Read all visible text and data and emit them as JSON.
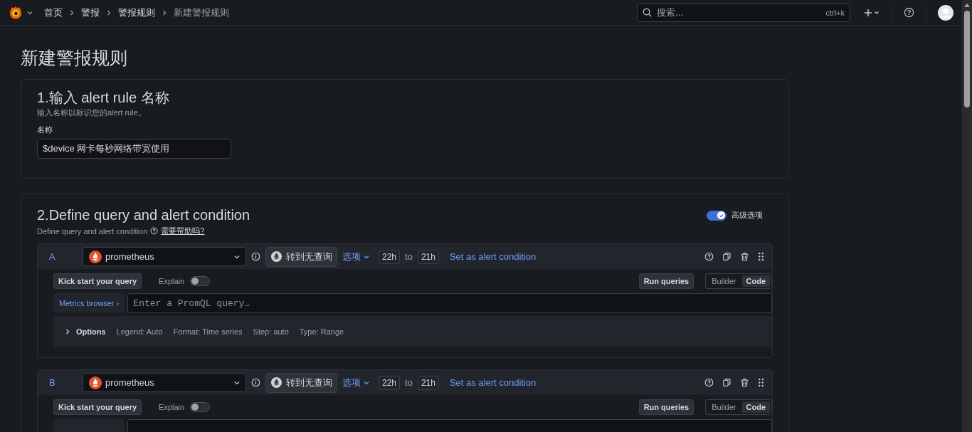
{
  "nav": {
    "breadcrumbs": [
      {
        "label": "首页",
        "current": false
      },
      {
        "label": "警报",
        "current": false
      },
      {
        "label": "警报规则",
        "current": false
      },
      {
        "label": "新建警报规则",
        "current": true
      }
    ],
    "search": {
      "placeholder": "搜索...",
      "shortcut": "ctrl+k"
    }
  },
  "page_title": "新建警报规则",
  "section_1": {
    "title": "1.输入 alert rule 名称",
    "description": "输入名称以标识您的alert rule。",
    "field_label": "名称",
    "field_value": "$device 网卡每秒网络带宽使用"
  },
  "section_2": {
    "title": "2.Define query and alert condition",
    "description": "Define query and alert condition",
    "help_link": "需要帮助吗?",
    "advanced": {
      "label": "高级选项",
      "on": true
    }
  },
  "queries": [
    {
      "ref": "A",
      "datasource": "prometheus",
      "convert": "转到无查询",
      "options_menu": "选项",
      "time_from": "22h",
      "to": "to",
      "time_to": "21h",
      "condition": "Set as alert condition",
      "kick_start": "Kick start your query",
      "explain": {
        "label": "Explain",
        "on": false
      },
      "run": "Run queries",
      "modes": [
        {
          "label": "Builder",
          "selected": false
        },
        {
          "label": "Code",
          "selected": true
        }
      ],
      "metrics_browser": "Metrics browser ›",
      "placeholder": "Enter a PromQL query…",
      "options": {
        "label": "Options",
        "items": [
          "Legend: Auto",
          "Format: Time series",
          "Step: auto",
          "Type: Range"
        ]
      }
    },
    {
      "ref": "B",
      "datasource": "prometheus",
      "convert": "转到无查询",
      "options_menu": "选项",
      "time_from": "22h",
      "to": "to",
      "time_to": "21h",
      "condition": "Set as alert condition",
      "kick_start": "Kick start your query",
      "explain": {
        "label": "Explain",
        "on": false
      },
      "run": "Run queries",
      "modes": [
        {
          "label": "Builder",
          "selected": false
        },
        {
          "label": "Code",
          "selected": true
        }
      ]
    }
  ]
}
